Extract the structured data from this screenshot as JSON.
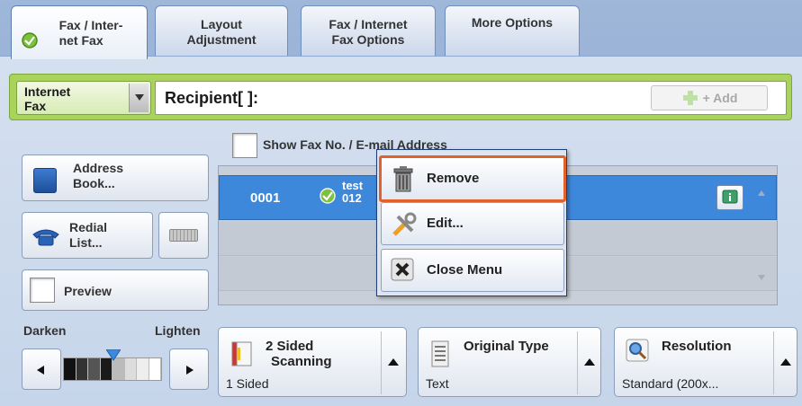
{
  "tabs": [
    {
      "label_1": "Fax / Inter-",
      "label_2": "net Fax",
      "active": true
    },
    {
      "label_1": "Layout",
      "label_2": "Adjustment"
    },
    {
      "label_1": "Fax / Internet",
      "label_2": "Fax Options"
    },
    {
      "label_1": "More Options",
      "label_2": ""
    }
  ],
  "recipient": {
    "type_1": "Internet",
    "type_2": "Fax",
    "label": "Recipient[   ]:",
    "add_label": "+ Add"
  },
  "left": {
    "address_1": "Address",
    "address_2": "Book...",
    "redial_1": "Redial",
    "redial_2": "List...",
    "preview": "Preview"
  },
  "show_fax_label": "Show Fax No. / E-mail Address",
  "list": {
    "rows": [
      {
        "num": "0001",
        "name_1": "test",
        "name_2": "012"
      }
    ]
  },
  "menu": {
    "remove": "Remove",
    "edit": "Edit...",
    "close": "Close Menu"
  },
  "density": {
    "darken": "Darken",
    "lighten": "Lighten"
  },
  "options": [
    {
      "title_1": "2 Sided",
      "title_2": "Scanning",
      "value": "1 Sided"
    },
    {
      "title_1": "Original Type",
      "value": "Text"
    },
    {
      "title_1": "Resolution",
      "value": "Standard (200x..."
    }
  ],
  "colors": {
    "accent": "#e0612a",
    "selection": "#3e88dc",
    "recipient_frame": "#a9d35a"
  }
}
